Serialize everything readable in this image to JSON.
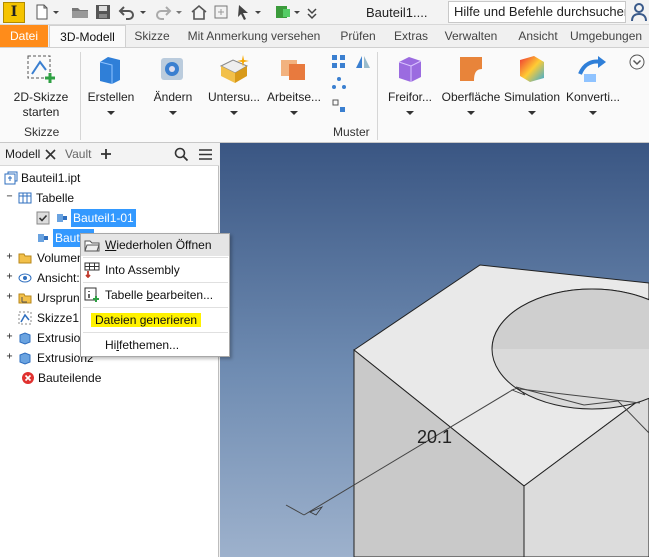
{
  "app": {
    "logo_letter": "I",
    "document_title": "Bauteil1....",
    "search_placeholder": "Hilfe und Befehle durchsuchen..."
  },
  "tabs": [
    {
      "label": "Datei"
    },
    {
      "label": "3D-Modell"
    },
    {
      "label": "Skizze"
    },
    {
      "label": "Mit Anmerkung versehen"
    },
    {
      "label": "Prüfen"
    },
    {
      "label": "Extras"
    },
    {
      "label": "Verwalten"
    },
    {
      "label": "Ansicht"
    },
    {
      "label": "Umgebungen"
    }
  ],
  "ribbon": {
    "sketch_button_line1": "2D-Skizze",
    "sketch_button_line2": "starten",
    "sketch_group": "Skizze",
    "buttons": [
      "Erstellen",
      "Ändern",
      "Untersu...",
      "Arbeitse...",
      "Freifor...",
      "Oberfläche",
      "Simulation",
      "Konverti..."
    ],
    "pattern_group": "Muster"
  },
  "browser": {
    "tab_model": "Modell",
    "tab_vault": "Vault",
    "tree": {
      "root": "Bauteil1.ipt",
      "table": "Tabelle",
      "member1": "Bauteil1-01",
      "member2_partial": "Bauteil",
      "solids_partial": "Volumenk",
      "view_partial": "Ansicht:",
      "origin_partial": "Ursprung",
      "sketch1": "Skizze1",
      "extrusion1_partial": "Extrusion",
      "extrusion2": "Extrusion2",
      "part_end": "Bauteilende"
    }
  },
  "context_menu": {
    "repeat_open_prefix": "",
    "repeat_open_hotkey": "W",
    "repeat_open_rest": "iederholen Öffnen",
    "into_assembly": "Into Assembly",
    "edit_table_prefix": "Tabelle ",
    "edit_table_hotkey": "b",
    "edit_table_rest": "earbeiten...",
    "generate_files_prefix": "Dateien ",
    "generate_files_hotkey": "g",
    "generate_files_rest": "enerieren",
    "help_prefix": "Hi",
    "help_hotkey": "l",
    "help_rest": "fethemen..."
  },
  "viewport": {
    "dimension_value": "20.1"
  },
  "colors": {
    "file_tab": "#ff8c1a",
    "selection": "#3399ff",
    "highlight": "#fff200",
    "viewport_top": "#3a5683"
  }
}
